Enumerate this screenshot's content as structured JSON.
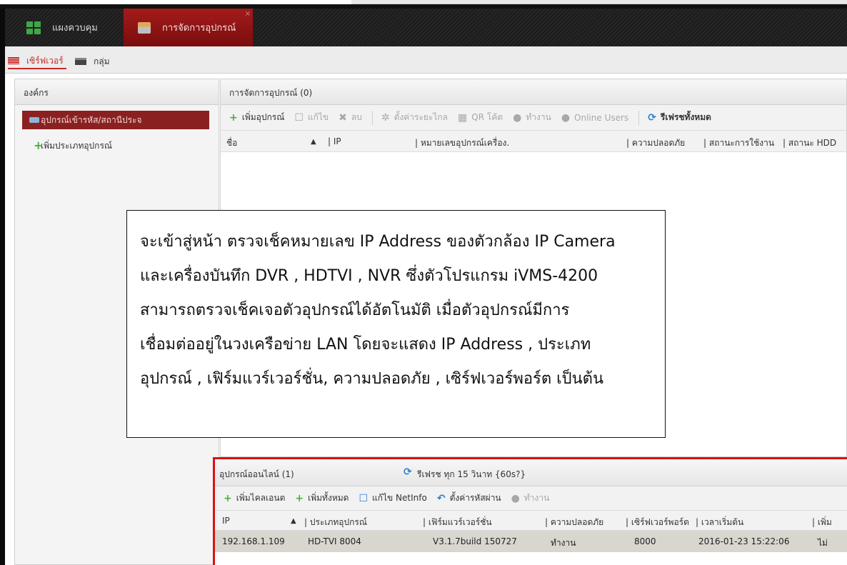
{
  "topbar": {
    "tab_control": "แผงควบคุม",
    "tab_device_mgmt": "การจัดการอุปกรณ์",
    "close_glyph": "×"
  },
  "subtabs": {
    "server": "เซิร์ฟเวอร์",
    "group": "กลุ่ม"
  },
  "org_panel": {
    "title": "องค์กร",
    "item_active": "อุปกรณ์เข้ารหัส/สถานีประจ",
    "item_add": "เพิ่มประเภทอุปกรณ์"
  },
  "device_panel": {
    "title": "การจัดการอุปกรณ์ (0)",
    "toolbar": {
      "add": "เพิ่มอุปกรณ์",
      "edit": "แก้ไข",
      "delete": "ลบ",
      "remote_config": "ตั้งค่าระยะไกล",
      "qr": "QR โค้ด",
      "activate": "ทำงาน",
      "online_users": "Online Users",
      "refresh_all": "รีเฟรชทั้งหมด"
    },
    "columns": [
      "ชื่อ",
      "IP",
      "หมายเลขอุปกรณ์เครื่อง.",
      "ความปลอดภัย",
      "สถานะการใช้งาน",
      "สถานะ HDD"
    ]
  },
  "online_panel": {
    "title": "อุปกรณ์ออนไลน์ (1)",
    "refresh_text": "รีเฟรช ทุก 15 วินาท {60s?}",
    "toolbar": {
      "add_client": "เพิ่มไคลเอนต",
      "add_all": "เพิ่มทั้งหมด",
      "edit_netinfo": "แก้ไข NetInfo",
      "reset_password": "ตั้งค่ารหัสผ่าน",
      "activate": "ทำงาน"
    },
    "columns": [
      "IP",
      "ประเภทอุปกรณ์",
      "เฟิร์มแวร์เวอร์ชั่น",
      "ความปลอดภัย",
      "เซิร์ฟเวอร์พอร์ต",
      "เวลาเริ่มต้น",
      "เพิ่ม"
    ],
    "rows": [
      {
        "ip": "192.168.1.109",
        "type": "HD-TVI 8004",
        "firmware": "V3.1.7build 150727",
        "security": "ทำงาน",
        "port": "8000",
        "start_time": "2016-01-23 15:22:06",
        "added": "ไม่"
      }
    ]
  },
  "callout": {
    "lines": [
      "จะเข้าสู่หน้า ตรวจเช็คหมายเลข IP Address ของตัวกล้อง IP Camera",
      "และเครื่องบันทึก DVR , HDTVI , NVR ซึ่งตัวโปรแกรม iVMS-4200",
      "สามารถตรวจเช็คเจอตัวอุปกรณ์ได้อัตโนมัติ เมื่อตัวอุปกรณ์มีการ",
      "เชื่อมต่ออยู่ในวงเครือข่าย LAN โดยจะแสดง IP Address , ประเภท",
      "อุปกรณ์ , เฟิร์มแวร์เวอร์ชั่น, ความปลอดภัย , เซิร์ฟเวอร์พอร์ต เป็นต้น"
    ]
  },
  "colors": {
    "accent_red": "#a41b1b",
    "highlight_border": "#e01010",
    "plus_green": "#49b03a",
    "refresh_blue": "#2c7fd6"
  }
}
